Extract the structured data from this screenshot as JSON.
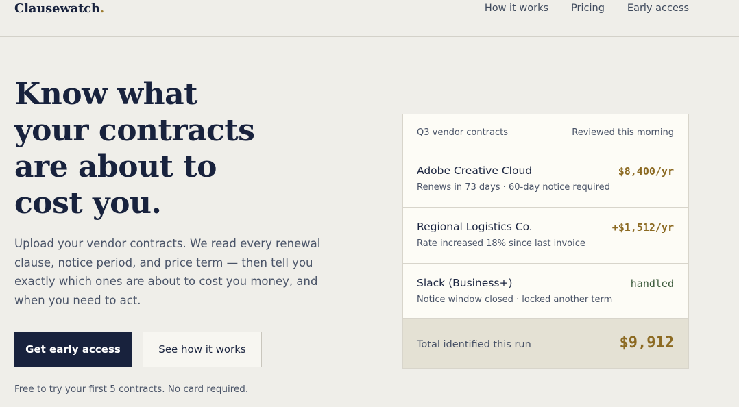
{
  "brand": {
    "name": "Clausewatch",
    "dot": "."
  },
  "nav": {
    "how_it_works": "How it works",
    "pricing": "Pricing",
    "early_access": "Early access"
  },
  "hero": {
    "headline_lines": [
      "Know what",
      "your contracts",
      "are about to",
      "cost you."
    ],
    "lede": "Upload your vendor contracts. We read every renewal clause, notice period, and price term — then tell you exactly which ones are about to cost you money, and when you need to act.",
    "primary_cta": "Get early access",
    "secondary_cta": "See how it works",
    "footnote": "Free to try your first 5 contracts. No card required."
  },
  "card": {
    "title": "Q3 vendor contracts",
    "status": "Reviewed this morning",
    "rows": [
      {
        "name": "Adobe Creative Cloud",
        "meta": "Renews in 73 days · 60-day notice required",
        "amount": "$8,400/yr"
      },
      {
        "name": "Regional Logistics Co.",
        "meta": "Rate increased 18% since last invoice",
        "amount": "+$1,512/yr"
      },
      {
        "name": "Slack (Business+)",
        "meta": "Notice window closed · locked another term",
        "amount": "handled"
      }
    ],
    "total_label": "Total identified this run",
    "total_value": "$9,912"
  },
  "colors": {
    "background": "#efeee9",
    "ink": "#18223d",
    "accent_gold": "#8c6a22",
    "handled_green": "#3b5a3b"
  }
}
